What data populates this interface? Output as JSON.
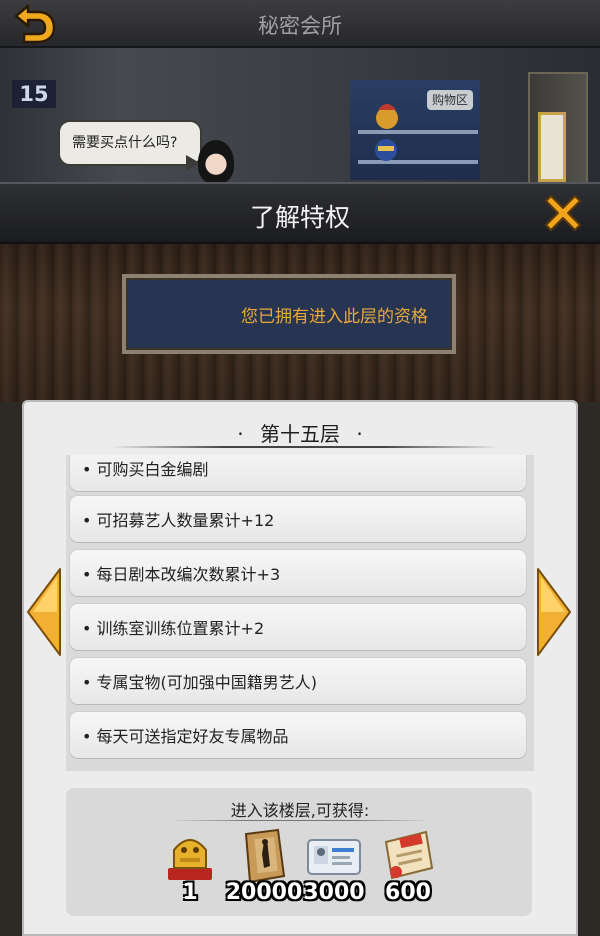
{
  "topbar": {
    "title": "秘密会所"
  },
  "scene": {
    "floor_number": "15",
    "shop_tag": "购物区",
    "npc_bubble": "需要买点什么吗?"
  },
  "modal": {
    "title": "了解特权",
    "status_text": "您已拥有进入此层的资格",
    "floor_title": "第十五层",
    "privileges": [
      "可购买白金编剧",
      "可招募艺人数量累计+12",
      "每日剧本改编次数累计+3",
      "训练室训练位置累计+2",
      "专属宝物(可加强中国籍男艺人)",
      "每天可送指定好友专属物品"
    ],
    "reward_title": "进入该楼层,可获得:",
    "rewards": [
      {
        "icon": "golden-trophy-icon",
        "count": "1"
      },
      {
        "icon": "script-scroll-icon",
        "count": "20000"
      },
      {
        "icon": "id-card-icon",
        "count": "3000"
      },
      {
        "icon": "work-letter-icon",
        "count": "600"
      }
    ]
  },
  "colors": {
    "accent_orange": "#f2a51a",
    "status_text": "#e8a93a",
    "board_blue": "#273452"
  }
}
